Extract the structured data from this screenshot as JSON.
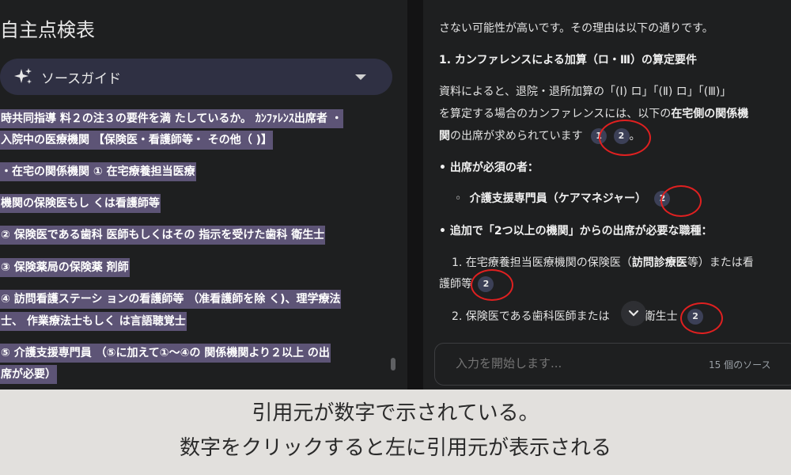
{
  "left": {
    "title": "自主点検表",
    "source_guide_label": "ソースガイド",
    "excerpt": [
      "時共同指導 料２の注３の要件を満 たしているか。 ｶﾝﾌｧﾚﾝｽ出席者 ・",
      "入院中の医療機関 【保険医・看護師等・ その他（ )】",
      "・在宅の関係機関 ① 在宅療養担当医療",
      "機関の保険医もし くは看護師等",
      "② 保険医である歯科 医師もしくはその 指示を受けた歯科 衛生士",
      "③ 保険薬局の保険薬 剤師",
      "④ 訪問看護ステーシ ョンの看護師等 （准看護師を除 く)、理学療法",
      "士、 作業療法士もしく は言語聴覚士",
      "⑤ 介護支援専門員 （⑤に加えて①～④の 関係機関より２以上 の出",
      "席が必要）"
    ]
  },
  "chat": {
    "intro": "さない可能性が高いです。その理由は以下の通りです。",
    "heading1": "1. カンファレンスによる加算（ロ・Ⅲ）の算定要件",
    "p1_line1": "資料によると、退院・退所加算の「(Ⅰ) ロ」「(Ⅱ) ロ」「(Ⅲ)」",
    "p1_line2_a": "を算定する場合のカンファレンスには、以下の",
    "p1_line2_b": "在宅側の関係機",
    "p1_line3_a": "関",
    "p1_line3_b": "の出席が求められています",
    "p1_end": "。",
    "citations_p1": [
      "1",
      "2"
    ],
    "required_label": "• 出席が必須の者：",
    "required_item": "介護支援専門員（ケアマネジャー）",
    "required_bullet": "◦",
    "citation_required": "2",
    "additional_label": "• 追加で「2つ以上の機関」からの出席が必要な職種：",
    "item1_a": "1. 在宅療養担当医療機関の保険医（",
    "item1_b": "訪問診療医",
    "item1_c": "等）または看",
    "item1_d": "護師等",
    "citation_item1": "2",
    "item2_a": "2. 保険医である歯科医師または",
    "item2_b": "科衛生士",
    "citation_item2": "2",
    "composer_placeholder": "入力を開始します...",
    "source_count": "15 個のソース"
  },
  "caption": {
    "line1": "引用元が数字で示されている。",
    "line2": "数字をクリックすると左に引用元が表示される"
  },
  "colors": {
    "highlight": "#5d5476",
    "annotation_circle": "#e02020",
    "citation_chip": "#3c4057"
  }
}
